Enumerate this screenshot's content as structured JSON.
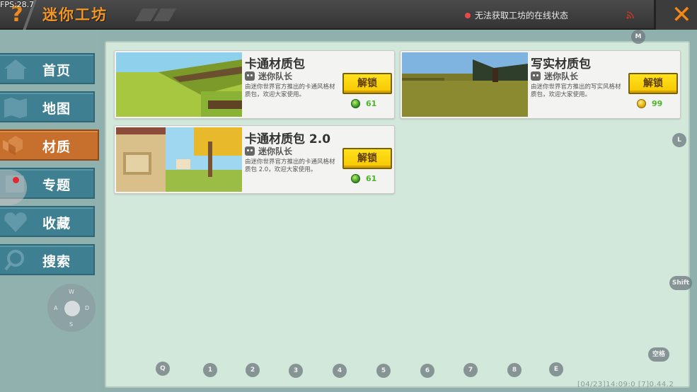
{
  "top_bar": {
    "fps": "FPS:28.7",
    "title": "迷你工坊",
    "help_icon": "?",
    "online_status": "无法获取工坊的在线状态",
    "close_icon": "close-icon"
  },
  "sidebar": {
    "items": [
      {
        "label": "首页",
        "icon": "home-icon",
        "active": false
      },
      {
        "label": "地图",
        "icon": "map-icon",
        "active": false
      },
      {
        "label": "材质",
        "icon": "material-icon",
        "active": true
      },
      {
        "label": "专题",
        "icon": "topic-icon",
        "active": false
      },
      {
        "label": "收藏",
        "icon": "heart-icon",
        "active": false
      },
      {
        "label": "搜索",
        "icon": "search-icon",
        "active": false
      }
    ]
  },
  "cards": [
    {
      "title": "卡通材质包",
      "author": "迷你队长",
      "description": "由迷你世界官方推出的卡通风格材质包，欢迎大家使用。",
      "button": "解锁",
      "price": "61",
      "currency": "green-gem"
    },
    {
      "title": "写实材质包",
      "author": "迷你队长",
      "description": "由迷你世界官方推出的写实风格材质包，欢迎大家使用。",
      "button": "解锁",
      "price": "99",
      "currency": "gold-coin"
    },
    {
      "title": "卡通材质包 2.0",
      "author": "迷你队长",
      "description": "由迷你世界官方推出的卡通风格材质包 2.0，欢迎大家使用。",
      "button": "解锁",
      "price": "61",
      "currency": "green-gem"
    }
  ],
  "key_hints": {
    "m": "M",
    "l": "L",
    "shift": "Shift",
    "space": "空格",
    "q": "Q",
    "e": "E",
    "numbers": [
      "1",
      "2",
      "3",
      "4",
      "5",
      "6",
      "7",
      "8"
    ],
    "joystick": {
      "w": "W",
      "a": "A",
      "s": "S",
      "d": "D"
    }
  },
  "footer": {
    "info": "[04/23]14:09:0  [7]0.44.2"
  },
  "colors": {
    "accent_orange": "#f29525",
    "sidebar_teal": "#3f7f92",
    "active_orange": "#c7702d",
    "panel_green": "#d2e8da",
    "button_yellow": "#ffe21d",
    "price_green": "#4bb52a"
  }
}
